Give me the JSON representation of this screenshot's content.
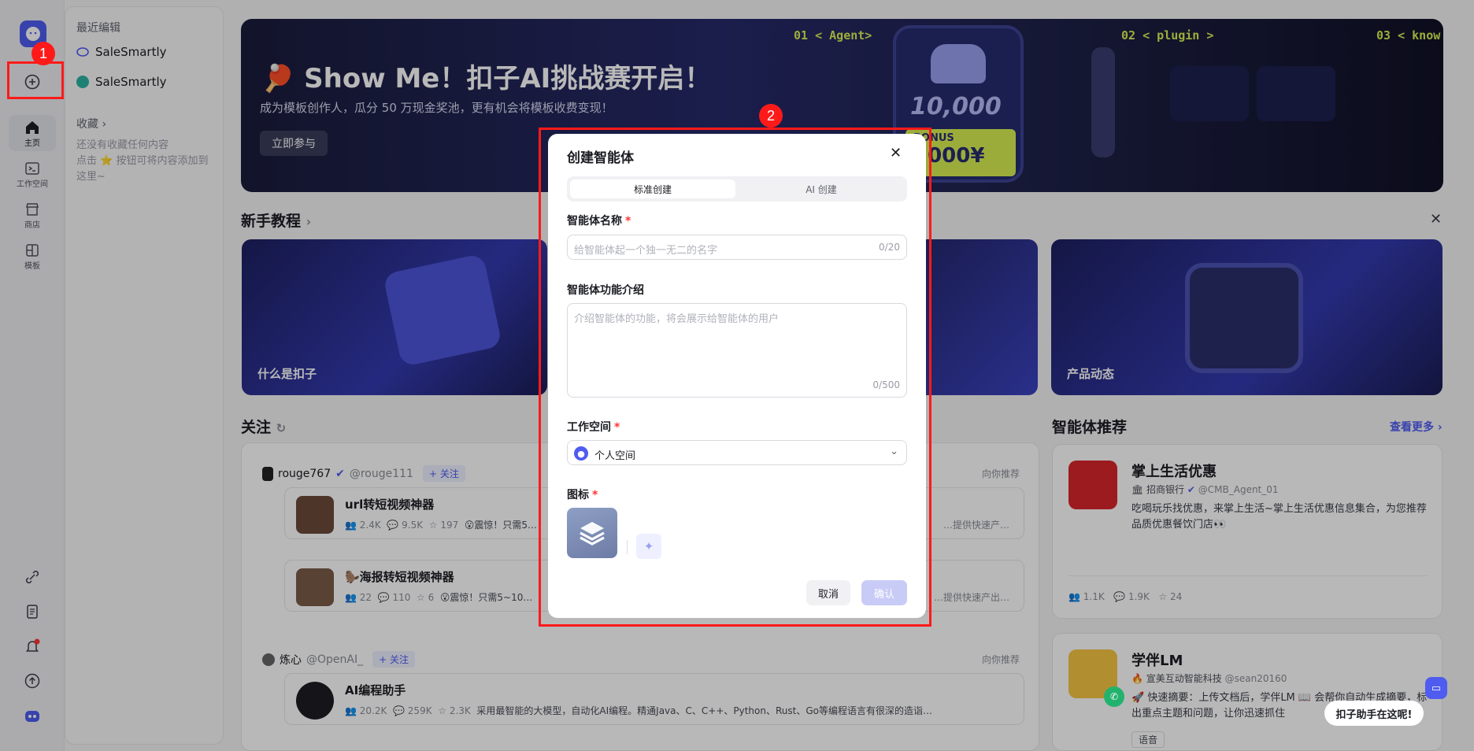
{
  "rail": {
    "home_label": "主页",
    "workspace_label": "工作空间",
    "store_label": "商店",
    "template_label": "模板"
  },
  "side": {
    "recent_heading": "最近编辑",
    "recent_items": [
      "SaleSmartly",
      "SaleSmartly"
    ],
    "favorites_heading": "收藏 ›",
    "favorites_empty_1": "还没有收藏任何内容",
    "favorites_empty_2": "点击 ⭐ 按钮可将内容添加到这里~"
  },
  "banner": {
    "title": "🏓 Show Me！扣子AI挑战赛开启！",
    "subtitle": "成为模板创作人，瓜分 50 万现金奖池，更有机会将模板收费变现！",
    "cta": "立即参与",
    "tag1": "01 < Agent>",
    "tag2": "02 < plugin >",
    "tag3": "03 < know",
    "amount": "10,000",
    "bonus": "BONUS",
    "bonus_amount": "3000¥"
  },
  "tutorial": {
    "title": "新手教程",
    "cards": [
      "什么是扣子",
      "产品动态"
    ]
  },
  "follow": {
    "title": "关注",
    "rec": "向你推荐",
    "follow_btn": "+ 关注",
    "user1_name": "rouge767",
    "user1_handle": "@rouge111",
    "items": [
      {
        "title": "url转短视频神器",
        "u": "2.4K",
        "c": "9.5K",
        "s": "197",
        "desc": "😮震惊！只需5…",
        "tail": "…提供快速产…"
      },
      {
        "title": "🦫海报转短视频神器",
        "u": "22",
        "c": "110",
        "s": "6",
        "desc": "😮震惊！只需5~10…",
        "tail": "…提供快速产出…"
      }
    ],
    "user2_name": "炼心",
    "user2_handle": "@OpenAI_",
    "item3": {
      "title": "AI编程助手",
      "u": "20.2K",
      "c": "259K",
      "s": "2.3K",
      "desc": "采用最智能的大模型，自动化AI编程。精通Java、C、C++、Python、Rust、Go等编程语言有很深的造诣…"
    }
  },
  "recommend": {
    "title": "智能体推荐",
    "more": "查看更多 ›",
    "a1": {
      "name": "掌上生活优惠",
      "org": "🏛 招商银行",
      "handle": "@CMB_Agent_01",
      "desc": "吃喝玩乐找优惠，来掌上生活~掌上生活优惠信息集合，为您推荐品质优惠餐饮门店👀",
      "u": "1.1K",
      "c": "1.9K",
      "s": "24"
    },
    "a2": {
      "name": "学伴LM",
      "org": "🔥 宣美互动智能科技",
      "handle": "@sean20160",
      "desc": "🚀 快速摘要：上传文档后，学伴LM 📖 会帮你自动生成摘要，标出重点主题和问题，让你迅速抓住",
      "tag": "语音"
    },
    "helper": "扣子助手在这呢!"
  },
  "modal": {
    "title": "创建智能体",
    "tab_standard": "标准创建",
    "tab_ai": "AI 创建",
    "name_label": "智能体名称",
    "name_placeholder": "给智能体起一个独一无二的名字",
    "name_count": "0/20",
    "desc_label": "智能体功能介绍",
    "desc_placeholder": "介绍智能体的功能，将会展示给智能体的用户",
    "desc_count": "0/500",
    "ws_label": "工作空间",
    "ws_value": "个人空间",
    "icon_label": "图标",
    "req": "*",
    "cancel": "取消",
    "confirm": "确认"
  },
  "badges": {
    "b1": "1",
    "b2": "2"
  },
  "colors": {
    "accent": "#4e5cf0",
    "red": "#ff1a1a",
    "confirm_disabled": "#c9cbf7"
  }
}
